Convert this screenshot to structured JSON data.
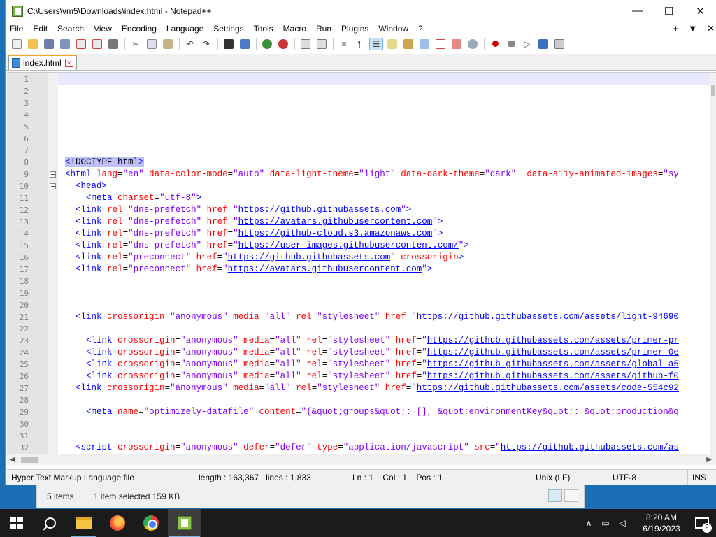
{
  "window": {
    "title": "C:\\Users\\vm5\\Downloads\\index.html - Notepad++",
    "minimize": "—",
    "maximize": "☐",
    "close": "✕"
  },
  "menu": {
    "items": [
      "File",
      "Edit",
      "Search",
      "View",
      "Encoding",
      "Language",
      "Settings",
      "Tools",
      "Macro",
      "Run",
      "Plugins",
      "Window",
      "?"
    ],
    "plus": "+",
    "down": "▼",
    "close": "✕"
  },
  "tab": {
    "label": "index.html"
  },
  "lines": [
    {
      "n": "1",
      "html": ""
    },
    {
      "n": "2",
      "html": ""
    },
    {
      "n": "3",
      "html": ""
    },
    {
      "n": "4",
      "html": ""
    },
    {
      "n": "5",
      "html": ""
    },
    {
      "n": "6",
      "html": ""
    },
    {
      "n": "7",
      "html": ""
    },
    {
      "n": "8",
      "html": "<span class='doctype'><span class='doctype-open'>&lt;</span>!DOCTYPE html<span class='doctype-open'>&gt;</span></span>"
    },
    {
      "n": "9",
      "html": "<span class='tag'>&lt;html</span> <span class='attr'>lang</span>=<span class='str'>\"en\"</span> <span class='attr'>data-color-mode</span>=<span class='str'>\"auto\"</span> <span class='attr'>data-light-theme</span>=<span class='str'>\"light\"</span> <span class='attr'>data-dark-theme</span>=<span class='str'>\"dark\"</span>  <span class='attr'>data-a11y-animated-images</span>=<span class='str'>\"sy</span>"
    },
    {
      "n": "10",
      "html": "  <span class='tag'>&lt;head&gt;</span>"
    },
    {
      "n": "11",
      "html": "    <span class='tag'>&lt;meta</span> <span class='attr'>charset</span>=<span class='str'>\"utf-8\"</span><span class='tag'>&gt;</span>"
    },
    {
      "n": "12",
      "html": "  <span class='tag'>&lt;link</span> <span class='attr'>rel</span>=<span class='str'>\"dns-prefetch\"</span> <span class='attr'>href</span>=<span class='str'>\"</span><span class='url'>https://github.githubassets.com</span><span class='str'>\"</span><span class='tag'>&gt;</span>"
    },
    {
      "n": "13",
      "html": "  <span class='tag'>&lt;link</span> <span class='attr'>rel</span>=<span class='str'>\"dns-prefetch\"</span> <span class='attr'>href</span>=<span class='str'>\"</span><span class='url'>https://avatars.githubusercontent.com</span><span class='str'>\"</span><span class='tag'>&gt;</span>"
    },
    {
      "n": "14",
      "html": "  <span class='tag'>&lt;link</span> <span class='attr'>rel</span>=<span class='str'>\"dns-prefetch\"</span> <span class='attr'>href</span>=<span class='str'>\"</span><span class='url'>https://github-cloud.s3.amazonaws.com</span><span class='str'>\"</span><span class='tag'>&gt;</span>"
    },
    {
      "n": "15",
      "html": "  <span class='tag'>&lt;link</span> <span class='attr'>rel</span>=<span class='str'>\"dns-prefetch\"</span> <span class='attr'>href</span>=<span class='str'>\"</span><span class='url'>https://user-images.githubusercontent.com/</span><span class='str'>\"</span><span class='tag'>&gt;</span>"
    },
    {
      "n": "16",
      "html": "  <span class='tag'>&lt;link</span> <span class='attr'>rel</span>=<span class='str'>\"preconnect\"</span> <span class='attr'>href</span>=<span class='str'>\"</span><span class='url'>https://github.githubassets.com</span><span class='str'>\"</span> <span class='attr'>crossorigin</span><span class='tag'>&gt;</span>"
    },
    {
      "n": "17",
      "html": "  <span class='tag'>&lt;link</span> <span class='attr'>rel</span>=<span class='str'>\"preconnect\"</span> <span class='attr'>href</span>=<span class='str'>\"</span><span class='url'>https://avatars.githubusercontent.com</span><span class='str'>\"</span><span class='tag'>&gt;</span>"
    },
    {
      "n": "18",
      "html": ""
    },
    {
      "n": "19",
      "html": ""
    },
    {
      "n": "20",
      "html": ""
    },
    {
      "n": "21",
      "html": "  <span class='tag'>&lt;link</span> <span class='attr'>crossorigin</span>=<span class='str'>\"anonymous\"</span> <span class='attr'>media</span>=<span class='str'>\"all\"</span> <span class='attr'>rel</span>=<span class='str'>\"stylesheet\"</span> <span class='attr'>href</span>=<span class='str'>\"</span><span class='url'>https://github.githubassets.com/assets/light-94690</span>"
    },
    {
      "n": "22",
      "html": ""
    },
    {
      "n": "23",
      "html": "    <span class='tag'>&lt;link</span> <span class='attr'>crossorigin</span>=<span class='str'>\"anonymous\"</span> <span class='attr'>media</span>=<span class='str'>\"all\"</span> <span class='attr'>rel</span>=<span class='str'>\"stylesheet\"</span> <span class='attr'>href</span>=<span class='str'>\"</span><span class='url'>https://github.githubassets.com/assets/primer-pr</span>"
    },
    {
      "n": "24",
      "html": "    <span class='tag'>&lt;link</span> <span class='attr'>crossorigin</span>=<span class='str'>\"anonymous\"</span> <span class='attr'>media</span>=<span class='str'>\"all\"</span> <span class='attr'>rel</span>=<span class='str'>\"stylesheet\"</span> <span class='attr'>href</span>=<span class='str'>\"</span><span class='url'>https://github.githubassets.com/assets/primer-0e</span>"
    },
    {
      "n": "25",
      "html": "    <span class='tag'>&lt;link</span> <span class='attr'>crossorigin</span>=<span class='str'>\"anonymous\"</span> <span class='attr'>media</span>=<span class='str'>\"all\"</span> <span class='attr'>rel</span>=<span class='str'>\"stylesheet\"</span> <span class='attr'>href</span>=<span class='str'>\"</span><span class='url'>https://github.githubassets.com/assets/global-a5</span>"
    },
    {
      "n": "26",
      "html": "    <span class='tag'>&lt;link</span> <span class='attr'>crossorigin</span>=<span class='str'>\"anonymous\"</span> <span class='attr'>media</span>=<span class='str'>\"all\"</span> <span class='attr'>rel</span>=<span class='str'>\"stylesheet\"</span> <span class='attr'>href</span>=<span class='str'>\"</span><span class='url'>https://github.githubassets.com/assets/github-f0</span>"
    },
    {
      "n": "27",
      "html": "  <span class='tag'>&lt;link</span> <span class='attr'>crossorigin</span>=<span class='str'>\"anonymous\"</span> <span class='attr'>media</span>=<span class='str'>\"all\"</span> <span class='attr'>rel</span>=<span class='str'>\"stylesheet\"</span> <span class='attr'>href</span>=<span class='str'>\"</span><span class='url'>https://github.githubassets.com/assets/code-554c92</span>"
    },
    {
      "n": "28",
      "html": ""
    },
    {
      "n": "29",
      "html": "    <span class='tag'>&lt;meta</span> <span class='attr'>name</span>=<span class='str'>\"optimizely-datafile\"</span> <span class='attr'>content</span>=<span class='str'>\"{&amp;quot;groups&amp;quot;: [], &amp;quot;environmentKey&amp;quot;: &amp;quot;production&amp;q</span>"
    },
    {
      "n": "30",
      "html": ""
    },
    {
      "n": "31",
      "html": ""
    },
    {
      "n": "32",
      "html": "  <span class='tag'>&lt;script</span> <span class='attr'>crossorigin</span>=<span class='str'>\"anonymous\"</span> <span class='attr'>defer</span>=<span class='str'>\"defer\"</span> <span class='attr'>type</span>=<span class='str'>\"application/javascript\"</span> <span class='attr'>src</span>=<span class='str'>\"</span><span class='url'>https://github.githubassets.com/as</span>"
    }
  ],
  "status": {
    "file_type": "Hyper Text Markup Language file",
    "length": "length : 163,367",
    "lines": "lines : 1,833",
    "ln": "Ln : 1",
    "col": "Col : 1",
    "pos": "Pos : 1",
    "eol": "Unix (LF)",
    "encoding": "UTF-8",
    "mode": "INS"
  },
  "explorer": {
    "items": "5 items",
    "selected": "1 item selected  159 KB"
  },
  "taskbar": {
    "time": "8:20 AM",
    "date": "6/19/2023",
    "notifications": "2"
  }
}
